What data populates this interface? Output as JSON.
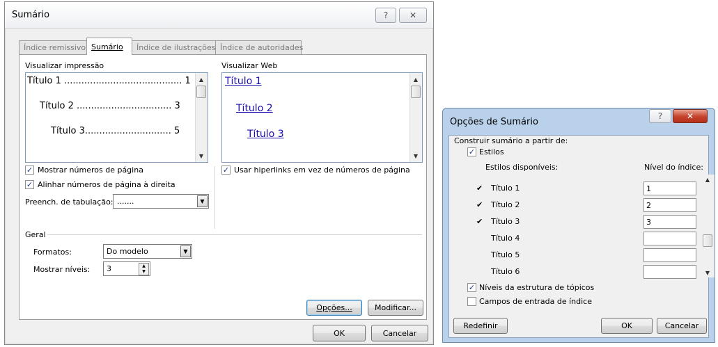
{
  "toc_dialog": {
    "title": "Sumário",
    "help_glyph": "?",
    "close_glyph": "✕",
    "tabs": [
      {
        "label": "Índice remissivo",
        "active": false
      },
      {
        "label": "Sumário",
        "active": true
      },
      {
        "label": "Índice de ilustrações",
        "active": false
      },
      {
        "label": "Índice de autoridades",
        "active": false
      }
    ],
    "print_preview": {
      "label": "Visualizar impressão",
      "lines": [
        "Título 1 ......................................... 1",
        "Título 2 ................................. 3",
        "Título 3.............................. 5"
      ]
    },
    "web_preview": {
      "label": "Visualizar Web",
      "lines": [
        "Título 1",
        "Título 2",
        "Título 3"
      ]
    },
    "show_page_numbers": {
      "label": "Mostrar números de página",
      "checked": true
    },
    "right_align_page_numbers": {
      "label": "Alinhar números de página à direita",
      "checked": true
    },
    "use_hyperlinks": {
      "label": "Usar hiperlinks em vez de números de página",
      "checked": true
    },
    "tab_leader": {
      "label": "Preench. de tabulação:",
      "value": "......."
    },
    "general": {
      "label": "Geral",
      "formats_label": "Formatos:",
      "formats_value": "Do modelo",
      "levels_label": "Mostrar níveis:",
      "levels_value": "3"
    },
    "options_button": "Opções...",
    "modify_button": "Modificar...",
    "ok_button": "OK",
    "cancel_button": "Cancelar"
  },
  "options_dialog": {
    "title": "Opções de Sumário",
    "help_glyph": "?",
    "close_glyph": "✕",
    "build_from_label": "Construir sumário a partir de:",
    "styles_checkbox": {
      "label": "Estilos",
      "checked": true
    },
    "available_styles_header": "Estilos disponíveis:",
    "level_header": "Nível do índice:",
    "styles": [
      {
        "checked": true,
        "name": "Título 1",
        "level": "1"
      },
      {
        "checked": true,
        "name": "Título 2",
        "level": "2"
      },
      {
        "checked": true,
        "name": "Título 3",
        "level": "3"
      },
      {
        "checked": false,
        "name": "Título 4",
        "level": ""
      },
      {
        "checked": false,
        "name": "Título 5",
        "level": ""
      },
      {
        "checked": false,
        "name": "Título 6",
        "level": ""
      }
    ],
    "outline_levels": {
      "label": "Níveis da estrutura de tópicos",
      "checked": true
    },
    "index_fields": {
      "label": "Campos de entrada de índice",
      "checked": false
    },
    "reset_button": "Redefinir",
    "ok_button": "OK",
    "cancel_button": "Cancelar"
  },
  "colors": {
    "link": "#1a0dab",
    "close_red": "#c4412a",
    "dialog_frame": "#b9d1ea"
  }
}
